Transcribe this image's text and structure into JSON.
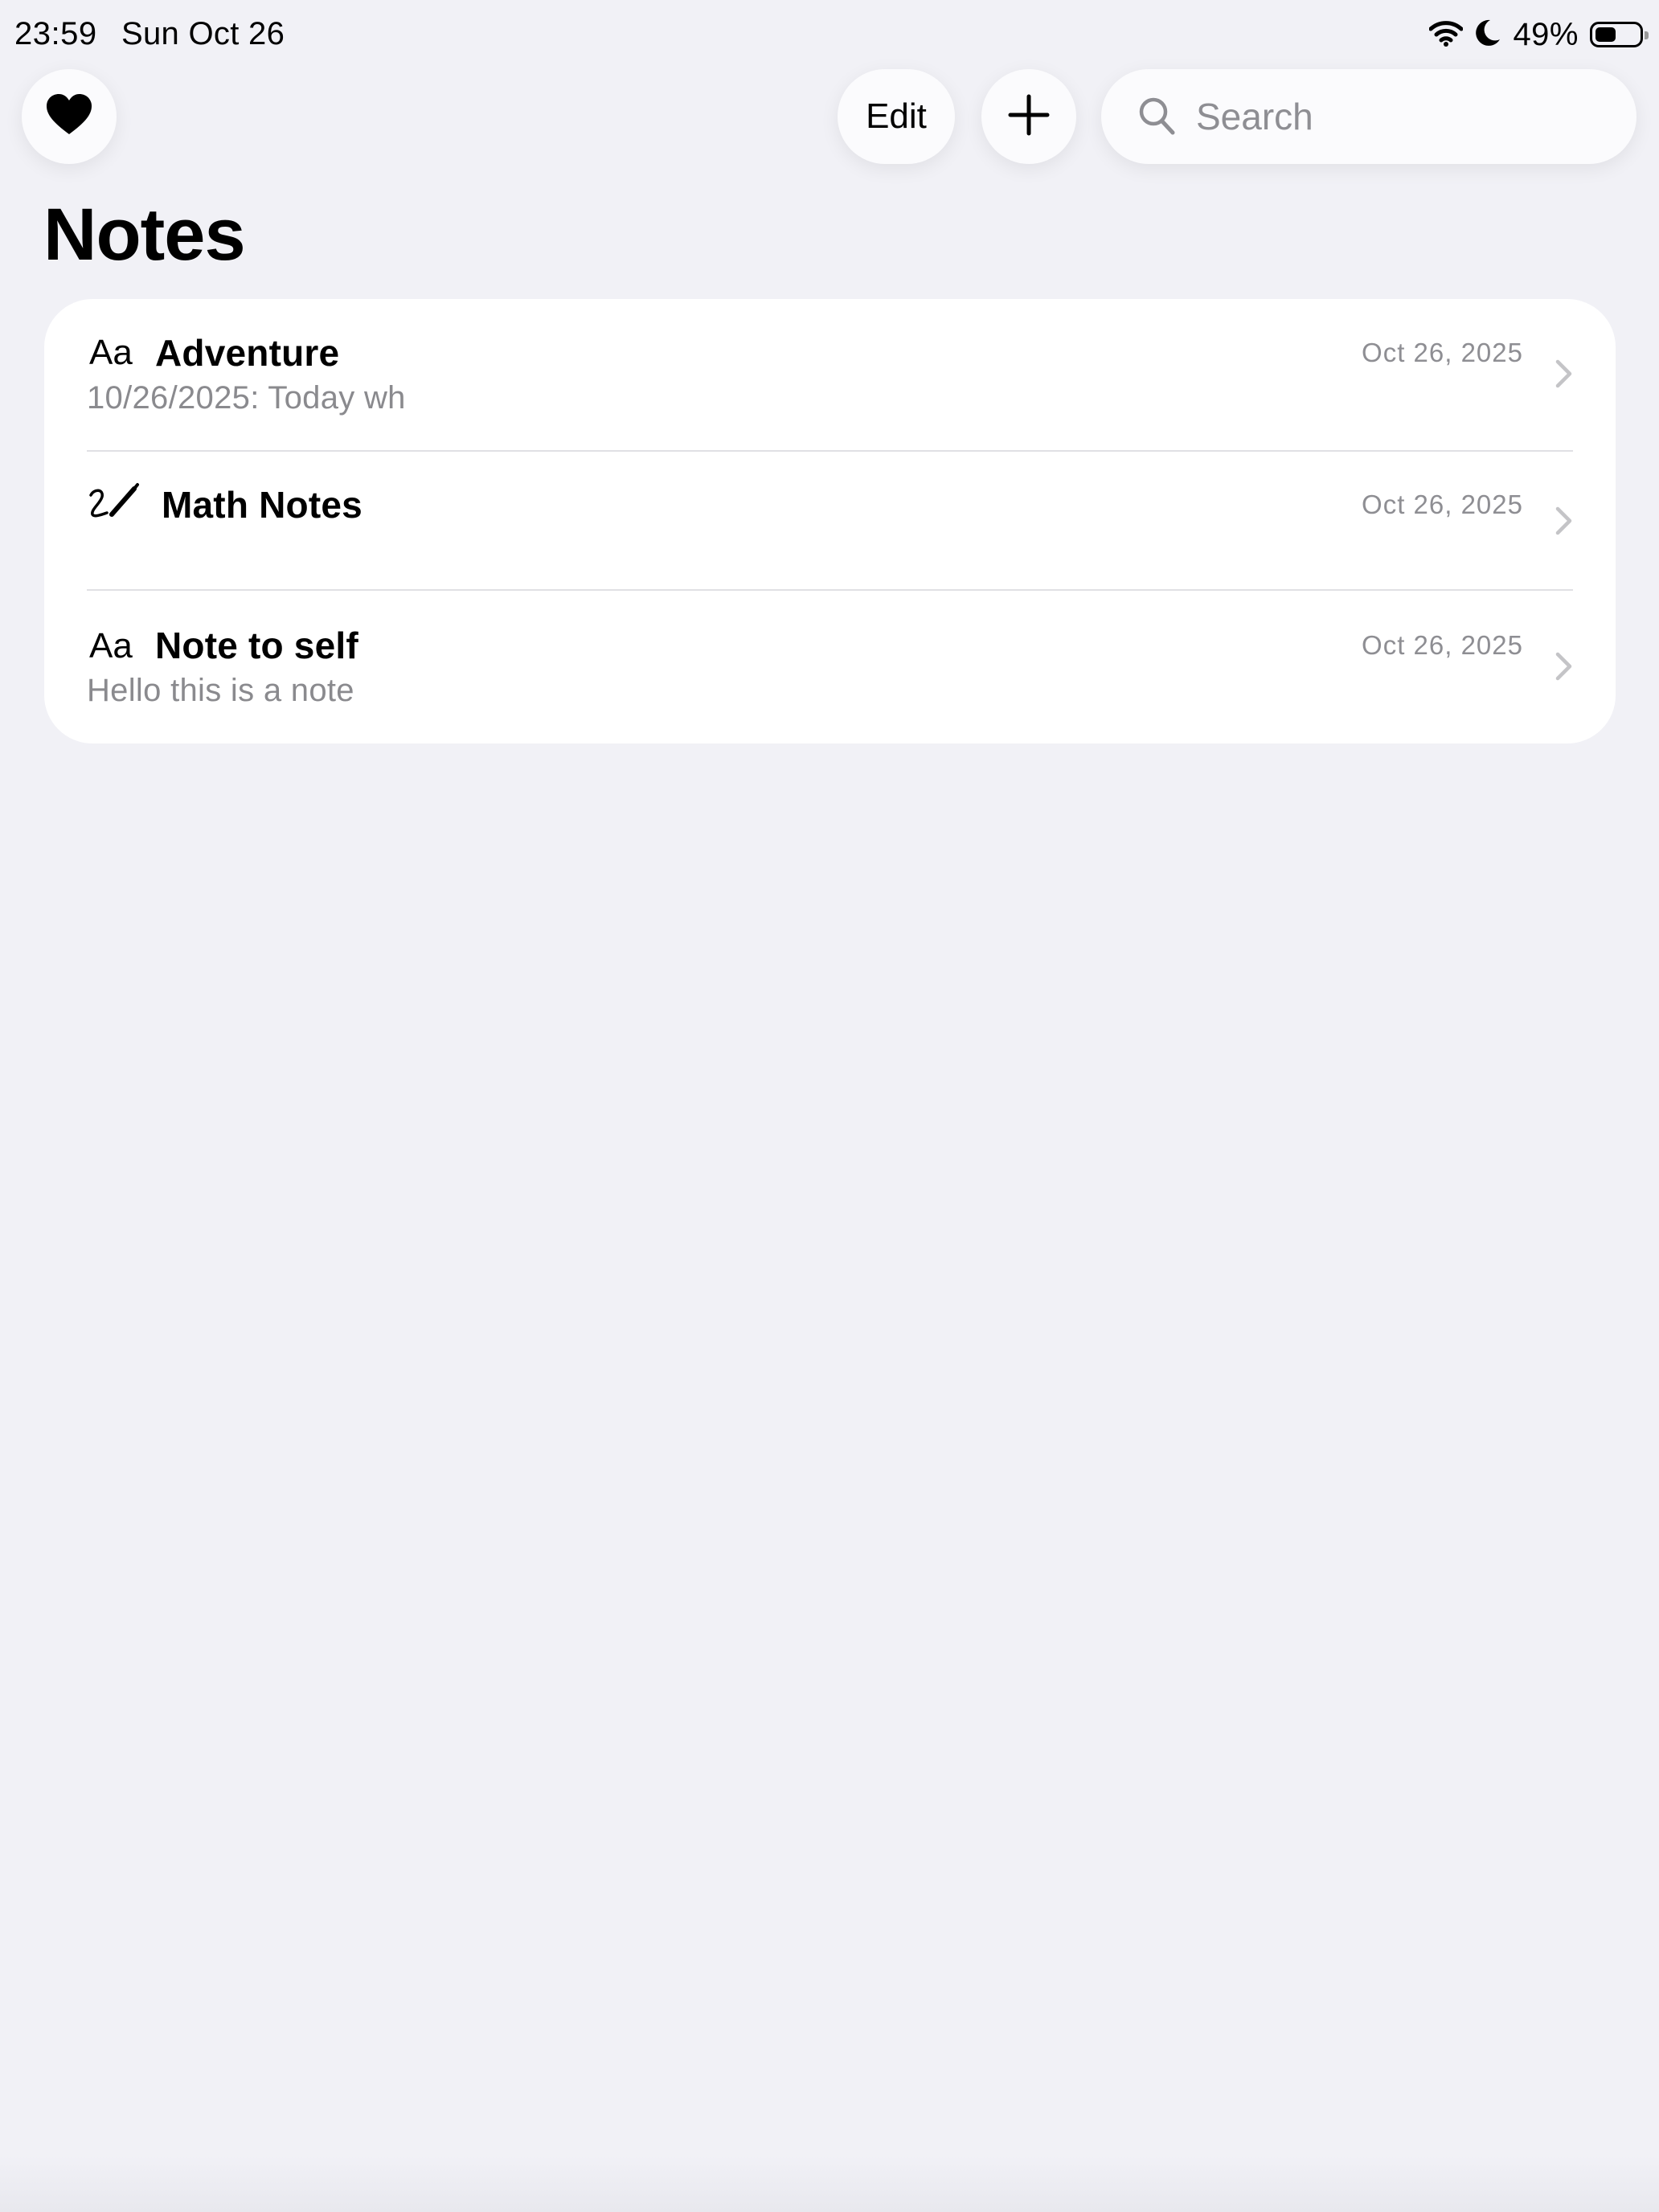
{
  "status_bar": {
    "time": "23:59",
    "date": "Sun Oct 26",
    "battery_percent_text": "49%",
    "battery_level": 0.49
  },
  "toolbar": {
    "edit_label": "Edit",
    "search_placeholder": "Search"
  },
  "page": {
    "title": "Notes"
  },
  "notes": [
    {
      "type_icon": "text-format-icon",
      "type_glyph": "Aa",
      "title": "Adventure",
      "preview": "10/26/2025: Today wh",
      "date": "Oct 26, 2025"
    },
    {
      "type_icon": "handwriting-icon",
      "type_glyph": "",
      "title": "Math Notes",
      "preview": "",
      "date": "Oct 26, 2025"
    },
    {
      "type_icon": "text-format-icon",
      "type_glyph": "Aa",
      "title": "Note to self",
      "preview": "Hello this is a note",
      "date": "Oct 26, 2025"
    }
  ],
  "colors": {
    "background": "#f1f1f6",
    "card": "#ffffff",
    "secondary_text": "#8e8e93",
    "divider": "#e0e0e4"
  }
}
